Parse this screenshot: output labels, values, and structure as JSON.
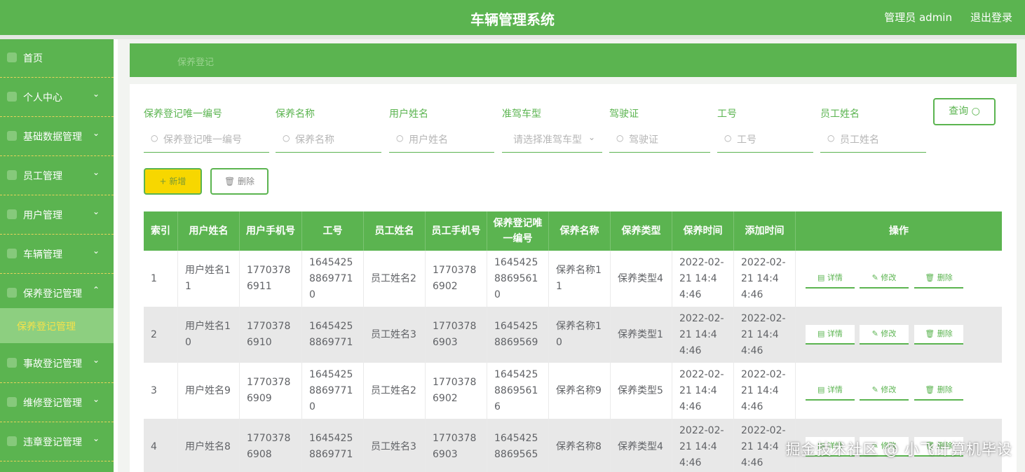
{
  "header": {
    "title": "车辆管理系统",
    "admin": "管理员 admin",
    "logout": "退出登录"
  },
  "sidebar": {
    "items": [
      {
        "label": "首页",
        "arrow": ""
      },
      {
        "label": "个人中心",
        "arrow": "⌄"
      },
      {
        "label": "基础数据管理",
        "arrow": "⌄"
      },
      {
        "label": "员工管理",
        "arrow": "⌄"
      },
      {
        "label": "用户管理",
        "arrow": "⌄"
      },
      {
        "label": "车辆管理",
        "arrow": "⌄"
      },
      {
        "label": "保养登记管理",
        "arrow": "⌃"
      },
      {
        "label": "事故登记管理",
        "arrow": "⌄"
      },
      {
        "label": "维修登记管理",
        "arrow": "⌄"
      },
      {
        "label": "违章登记管理",
        "arrow": "⌄"
      }
    ],
    "subitem": "保养登记管理"
  },
  "breadcrumb": "保养登记",
  "filters": [
    {
      "label": "保养登记唯一编号",
      "placeholder": "保养登记唯一编号"
    },
    {
      "label": "保养名称",
      "placeholder": "保养名称"
    },
    {
      "label": "用户姓名",
      "placeholder": "用户姓名"
    },
    {
      "label": "准驾车型",
      "placeholder": "请选择准驾车型"
    },
    {
      "label": "驾驶证",
      "placeholder": "驾驶证"
    },
    {
      "label": "工号",
      "placeholder": "工号"
    },
    {
      "label": "员工姓名",
      "placeholder": "员工姓名"
    }
  ],
  "buttons": {
    "query": "查询",
    "add": "新增",
    "delete": "删除"
  },
  "table": {
    "headers": [
      "索引",
      "用户姓名",
      "用户手机号",
      "工号",
      "员工姓名",
      "员工手机号",
      "保养登记唯一编号",
      "保养名称",
      "保养类型",
      "保养时间",
      "添加时间",
      "操作"
    ],
    "rows": [
      [
        "1",
        "用户姓名11",
        "17703786911",
        "164542588697710",
        "员工姓名2",
        "17703786902",
        "164542588695610",
        "保养名称11",
        "保养类型4",
        "2022-02-21 14:44:46",
        "2022-02-21 14:44:46"
      ],
      [
        "2",
        "用户姓名10",
        "17703786910",
        "16454258869771",
        "员工姓名3",
        "17703786903",
        "16454258869569",
        "保养名称10",
        "保养类型1",
        "2022-02-21 14:44:46",
        "2022-02-21 14:44:46"
      ],
      [
        "3",
        "用户姓名9",
        "17703786909",
        "164542588697710",
        "员工姓名2",
        "17703786902",
        "164542588695616",
        "保养名称9",
        "保养类型5",
        "2022-02-21 14:44:46",
        "2022-02-21 14:44:46"
      ],
      [
        "4",
        "用户姓名8",
        "17703786908",
        "16454258869771",
        "员工姓名3",
        "17703786903",
        "16454258869565",
        "保养名称8",
        "保养类型4",
        "2022-02-21 14:44:46",
        "2022-02-21 14:44:46"
      ]
    ],
    "actions": {
      "detail": "详情",
      "edit": "修改",
      "remove": "删除"
    }
  },
  "watermark": "掘金技术社区 @ 小飞计算机毕设"
}
